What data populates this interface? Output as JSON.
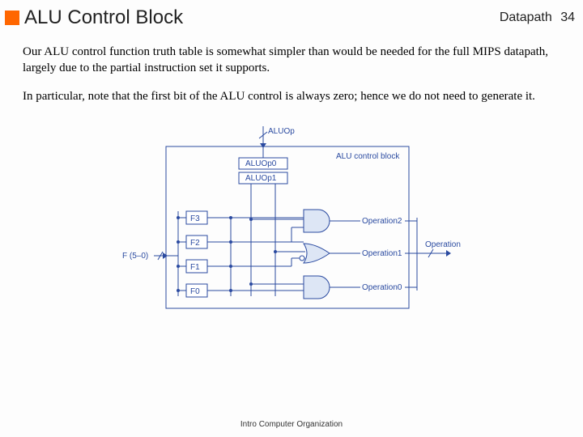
{
  "header": {
    "title": "ALU Control Block",
    "section": "Datapath",
    "page": "34"
  },
  "paragraphs": {
    "p1": "Our ALU control function truth table is somewhat simpler than would be needed for the full MIPS datapath, largely due to the partial instruction set it supports.",
    "p2": "In particular, note that the first bit of the ALU control is always zero; hence we do not need to generate it."
  },
  "diagram": {
    "top_input": "ALUOp",
    "aluop_bits": [
      "ALUOp0",
      "ALUOp1"
    ],
    "left_input": "F (5–0)",
    "f_bits": [
      "F3",
      "F2",
      "F1",
      "F0"
    ],
    "block_label": "ALU control block",
    "outputs": [
      "Operation2",
      "Operation1",
      "Operation0"
    ],
    "output_bus": "Operation"
  },
  "footer": "Intro Computer Organization"
}
